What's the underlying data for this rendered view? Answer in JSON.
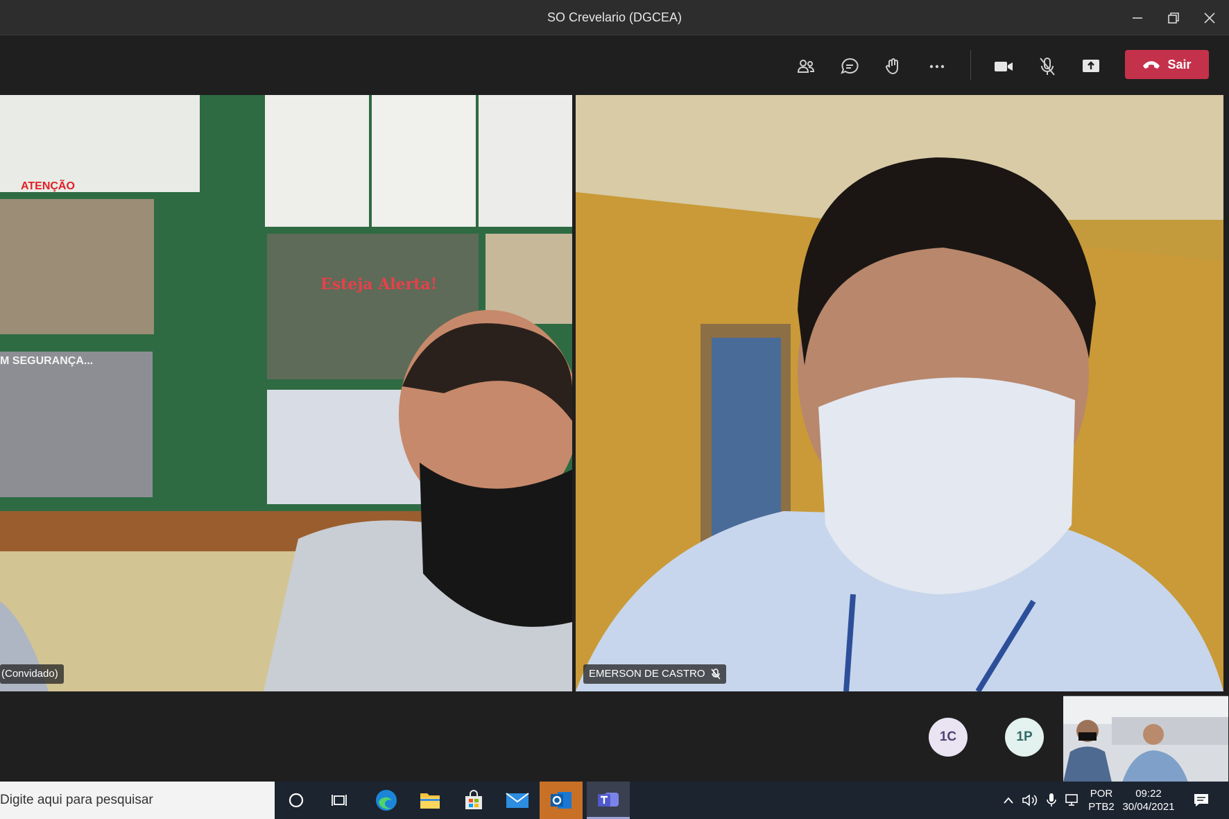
{
  "window": {
    "title": "SO Crevelario (DGCEA)"
  },
  "toolbar": {
    "leave_label": "Sair"
  },
  "participants": {
    "left_name": "(Convidado)",
    "right_name": "EMERSON DE CASTRO"
  },
  "stage_left": {
    "poster1": "ATENÇÃO",
    "poster2": "Esteja Alerta!",
    "poster3": "M SEGURANÇA..."
  },
  "roster": {
    "badge1": "1C",
    "badge2": "1P"
  },
  "taskbar": {
    "search_placeholder": "Digite aqui para pesquisar",
    "lang_line1": "POR",
    "lang_line2": "PTB2",
    "time": "09:22",
    "date": "30/04/2021"
  },
  "colors": {
    "leave": "#c4314b",
    "badge_c": "#e9e3f2",
    "badge_p": "#e3f1ef",
    "teams_accent": "#6264a7"
  }
}
